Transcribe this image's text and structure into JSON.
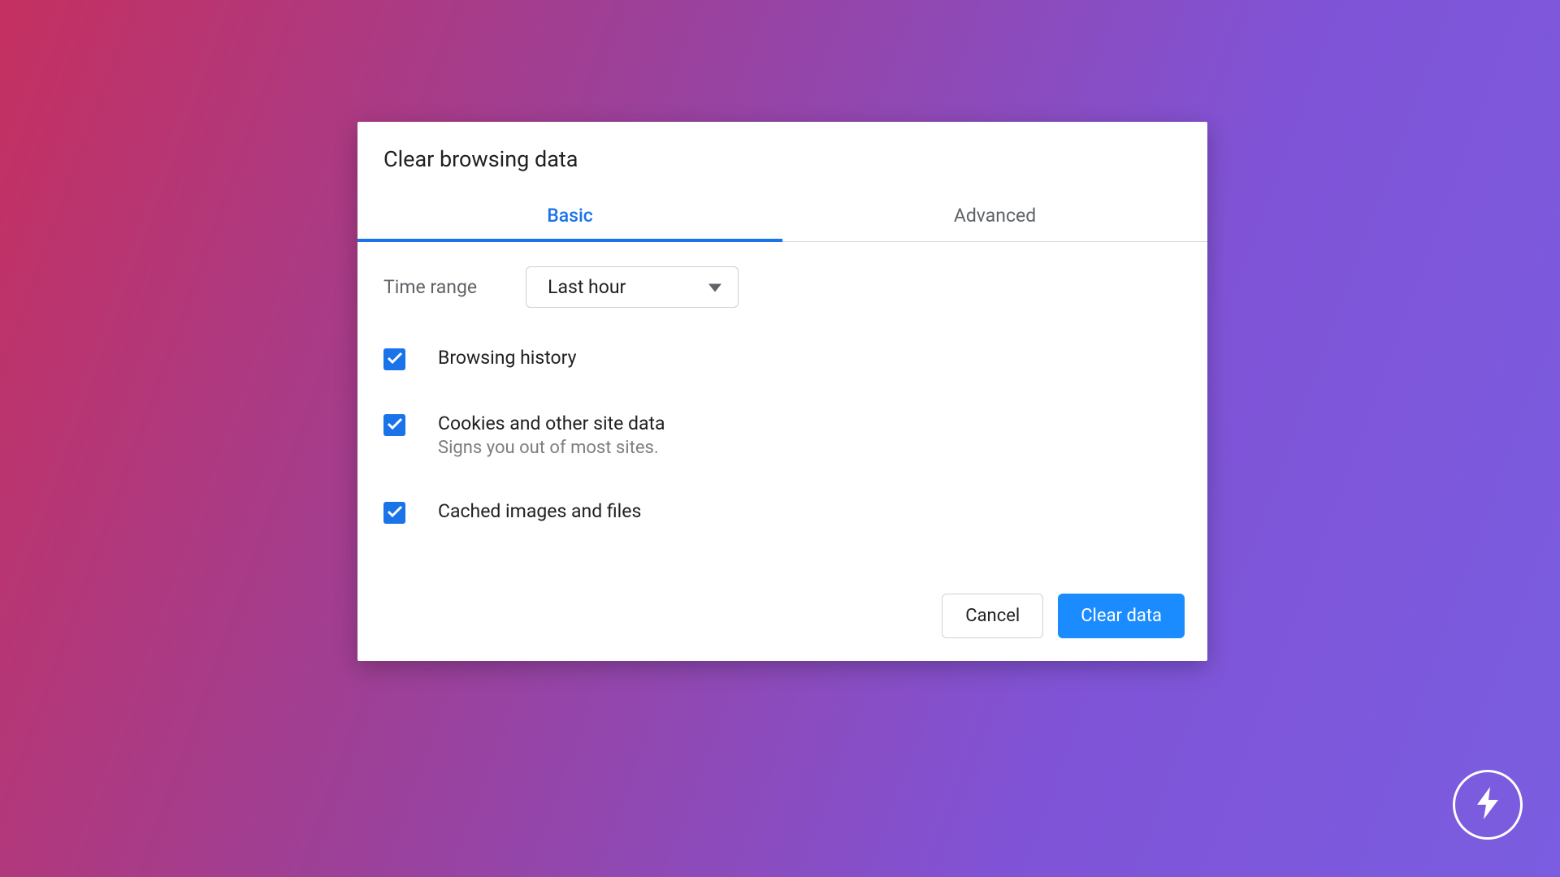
{
  "dialog": {
    "title": "Clear browsing data",
    "tabs": {
      "basic": "Basic",
      "advanced": "Advanced"
    },
    "time": {
      "label": "Time range",
      "value": "Last hour"
    },
    "items": {
      "browsing": {
        "label": "Browsing history"
      },
      "cookies": {
        "label": "Cookies and other site data",
        "sublabel": "Signs you out of most sites."
      },
      "cached": {
        "label": "Cached images and files"
      }
    },
    "buttons": {
      "cancel": "Cancel",
      "clear": "Clear data"
    }
  },
  "colors": {
    "accent": "#1a73e8",
    "primary_button": "#1a8cff"
  }
}
